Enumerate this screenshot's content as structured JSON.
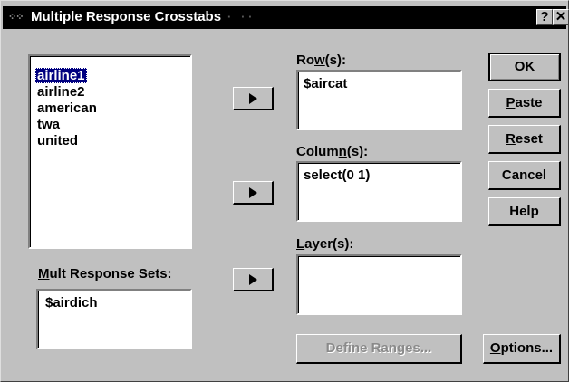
{
  "window": {
    "title": "Multiple Response Crosstabs",
    "title_icon": "grip-dots-icon",
    "help_glyph": "?",
    "close_glyph": "✕"
  },
  "variables_list": {
    "items": [
      "airline1",
      "airline2",
      "american",
      "twa",
      "united"
    ],
    "selected_index": 0
  },
  "mult_response": {
    "label_prefix": "",
    "label_underlined": "M",
    "label_rest": "ult Response Sets:",
    "items": [
      "$airdich"
    ]
  },
  "rows": {
    "label_prefix": "Ro",
    "label_underlined": "w",
    "label_rest": "(s):",
    "items": [
      "$aircat"
    ]
  },
  "columns": {
    "label_prefix": "Colum",
    "label_underlined": "n",
    "label_rest": "(s):",
    "items": [
      "select(0 1)"
    ]
  },
  "layers": {
    "label_prefix": "",
    "label_underlined": "L",
    "label_rest": "ayer(s):",
    "items": []
  },
  "buttons": {
    "ok": "OK",
    "paste_u": "P",
    "paste_rest": "aste",
    "reset_u": "R",
    "reset_rest": "eset",
    "cancel": "Cancel",
    "help": "Help",
    "define_ranges": "Define Ranges...",
    "options_u": "O",
    "options_rest": "ptions..."
  }
}
